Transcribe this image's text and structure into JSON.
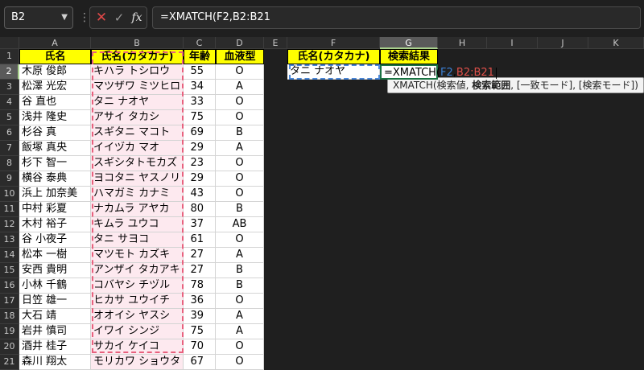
{
  "formula_bar": {
    "name_box": "B2",
    "cancel_icon": "close-icon",
    "confirm_icon": "check-icon",
    "fx_label": "fx",
    "formula": "=XMATCH(F2,B2:B21"
  },
  "columns": [
    "A",
    "B",
    "C",
    "D",
    "E",
    "F",
    "G",
    "H",
    "I",
    "J",
    "K"
  ],
  "selected_column": "G",
  "selected_row": "2",
  "rows": [
    "1",
    "2",
    "3",
    "4",
    "5",
    "6",
    "7",
    "8",
    "9",
    "10",
    "11",
    "12",
    "13",
    "14",
    "15",
    "16",
    "17",
    "18",
    "19",
    "20",
    "21"
  ],
  "table": {
    "headers": [
      "氏名",
      "氏名(カタカナ)",
      "年齢",
      "血液型"
    ],
    "records": [
      [
        "木原 俊郎",
        "キハラ トシロウ",
        "55",
        "O"
      ],
      [
        "松澤 光宏",
        "マツザワ ミツヒロ",
        "34",
        "A"
      ],
      [
        "谷 直也",
        "タニ ナオヤ",
        "33",
        "O"
      ],
      [
        "浅井 隆史",
        "アサイ タカシ",
        "75",
        "O"
      ],
      [
        "杉谷 真",
        "スギタニ マコト",
        "69",
        "B"
      ],
      [
        "飯塚 真央",
        "イイヅカ マオ",
        "29",
        "A"
      ],
      [
        "杉下 智一",
        "スギシタトモカズ",
        "23",
        "O"
      ],
      [
        "横谷 泰典",
        "ヨコタニ ヤスノリ",
        "29",
        "O"
      ],
      [
        "浜上 加奈美",
        "ハマガミ カナミ",
        "43",
        "O"
      ],
      [
        "中村 彩夏",
        "ナカムラ アヤカ",
        "80",
        "B"
      ],
      [
        "木村 裕子",
        "キムラ ユウコ",
        "37",
        "AB"
      ],
      [
        "谷 小夜子",
        "タニ サヨコ",
        "61",
        "O"
      ],
      [
        "松本 一樹",
        "マツモト カズキ",
        "27",
        "A"
      ],
      [
        "安西 貴明",
        "アンザイ タカアキ",
        "27",
        "B"
      ],
      [
        "小林 千鶴",
        "コバヤシ チヅル",
        "78",
        "B"
      ],
      [
        "日笠 雄一",
        "ヒカサ ユウイチ",
        "36",
        "O"
      ],
      [
        "大石 靖",
        "オオイシ ヤスシ",
        "39",
        "A"
      ],
      [
        "岩井 慎司",
        "イワイ シンジ",
        "75",
        "A"
      ],
      [
        "酒井 桂子",
        "サカイ ケイコ",
        "70",
        "O"
      ],
      [
        "森川 翔太",
        "モリカワ ショウタ",
        "67",
        "O"
      ]
    ]
  },
  "lookup": {
    "header_key": "氏名(カタカナ)",
    "header_result": "検索結果",
    "key_value": "タニ ナオヤ",
    "formula_prefix": "=XMATCH(",
    "formula_arg1": "F2",
    "formula_comma": ",",
    "formula_arg2": "B2:B21"
  },
  "tooltip": {
    "fn": "XMATCH(",
    "arg1": "検索値, ",
    "arg2": "検索範囲",
    "rest": ", [一致モード], [検索モード])"
  }
}
